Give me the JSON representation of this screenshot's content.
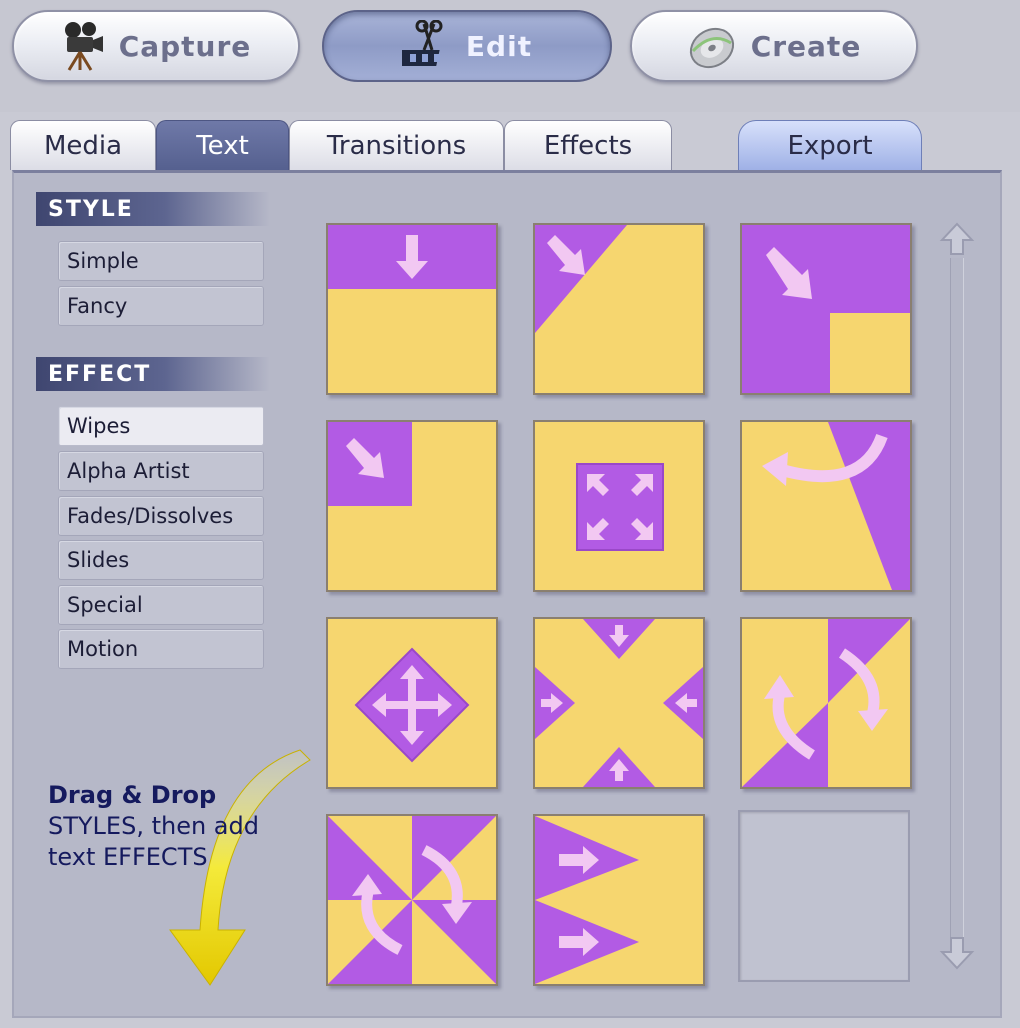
{
  "modes": [
    {
      "label": "Capture",
      "icon": "movie-camera-icon"
    },
    {
      "label": "Edit",
      "icon": "scissors-icon"
    },
    {
      "label": "Create",
      "icon": "disc-icon"
    }
  ],
  "active_mode": "Edit",
  "tabs": [
    {
      "label": "Media"
    },
    {
      "label": "Text"
    },
    {
      "label": "Transitions"
    },
    {
      "label": "Effects"
    },
    {
      "label": "Export"
    }
  ],
  "active_tab": "Text",
  "style_section": {
    "header": "STYLE",
    "items": [
      "Simple",
      "Fancy"
    ]
  },
  "effect_section": {
    "header": "EFFECT",
    "items": [
      "Wipes",
      "Alpha Artist",
      "Fades/Dissolves",
      "Slides",
      "Special",
      "Motion"
    ],
    "selected": "Wipes"
  },
  "hint": {
    "title": "Drag & Drop",
    "line1": "STYLES, then add",
    "line2": "text EFFECTS"
  },
  "colors": {
    "tile_yellow": "#f6d66f",
    "tile_purple": "#b25be4",
    "arrow_light": "#f2c8f2"
  },
  "tiles": [
    "wipe-down-icon",
    "wipe-diagonal-corner-icon",
    "wipe-diagonal-box-icon",
    "wipe-corner-box-icon",
    "wipe-expand-center-icon",
    "wipe-clock-sweep-icon",
    "wipe-diamond-expand-icon",
    "wipe-converge-center-icon",
    "wipe-split-rotate-icon",
    "wipe-pinwheel-icon",
    "wipe-arrow-right-icon",
    "empty-slot"
  ]
}
